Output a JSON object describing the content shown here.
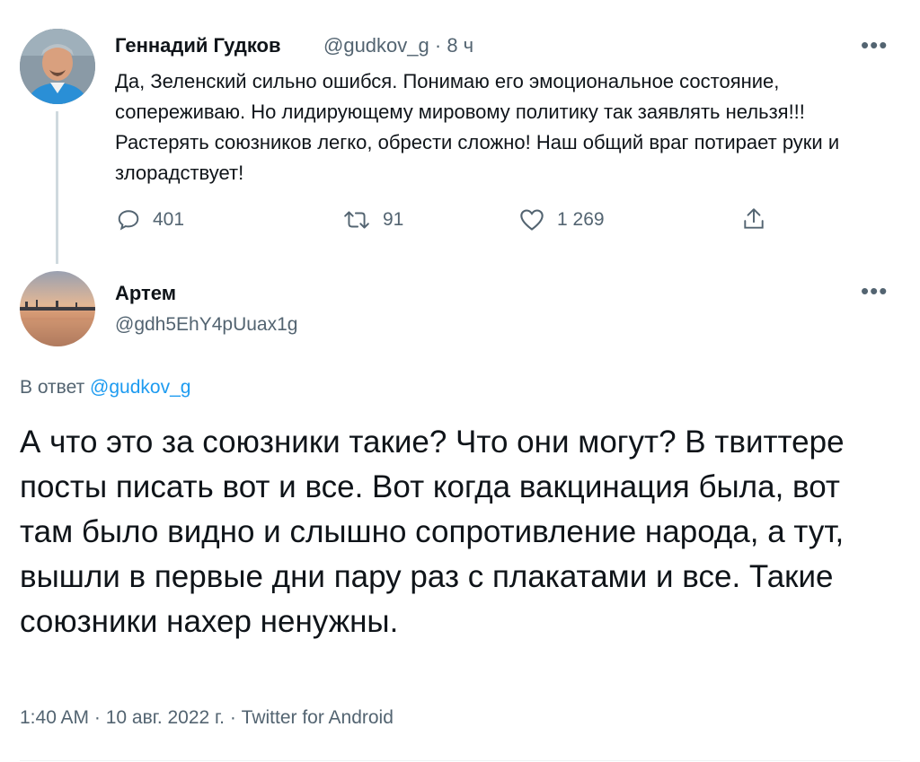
{
  "tweet1": {
    "author_name": "Геннадий Гудков",
    "handle": "@gudkov_g",
    "separator": "·",
    "time": "8 ч",
    "text": "Да, Зеленский сильно ошибся. Понимаю его эмоциональное состояние, сопереживаю. Но лидирующему мировому политику так заявлять нельзя!!! Растерять союзников легко, обрести сложно! Наш общий враг потирает руки и злорадствует!",
    "replies": "401",
    "retweets": "91",
    "likes": "1 269",
    "more_icon": "more-dots-icon"
  },
  "tweet2": {
    "author_name": "Артем",
    "handle": "@gdh5EhY4pUuax1g",
    "reply_prefix": "В ответ",
    "reply_mention": "@gudkov_g",
    "text": "А что это за союзники такие? Что они могут? В твиттере посты писать вот и все. Вот когда вакцинация была, вот там было видно и слышно сопротивление народа, а тут, вышли в первые дни пару раз с плакатами и все. Такие союзники нахер ненужны.",
    "timestamp": "1:40 AM · 10 авг. 2022 г. · Twitter for Android"
  },
  "colors": {
    "text_primary": "#0f1419",
    "text_secondary": "#536471",
    "link": "#1d9bf0",
    "thread_line": "#cfd9de"
  }
}
